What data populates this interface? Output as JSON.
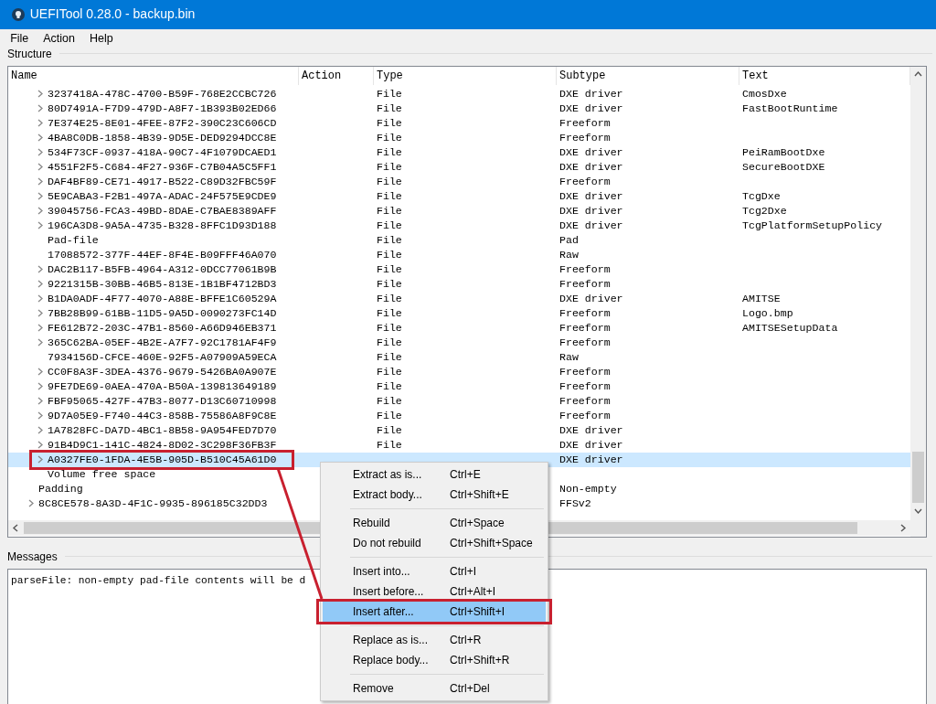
{
  "window": {
    "title": "UEFITool 0.28.0 - backup.bin"
  },
  "menu_bar": [
    "File",
    "Action",
    "Help"
  ],
  "structure": {
    "label": "Structure",
    "columns": [
      "Name",
      "Action",
      "Type",
      "Subtype",
      "Text"
    ],
    "items": [
      {
        "children": [
          {
            "name": "3237418A-478C-4700-B59F-768E2CCBC726",
            "type": "File",
            "subtype": "DXE driver",
            "text": "CmosDxe",
            "expandable": true,
            "selected": false
          },
          {
            "name": "80D7491A-F7D9-479D-A8F7-1B393B02ED66",
            "type": "File",
            "subtype": "DXE driver",
            "text": "FastBootRuntime",
            "expandable": true,
            "selected": false
          },
          {
            "name": "7E374E25-8E01-4FEE-87F2-390C23C606CD",
            "type": "File",
            "subtype": "Freeform",
            "expandable": true,
            "selected": false
          },
          {
            "name": "4BA8C0DB-1858-4B39-9D5E-DED9294DCC8E",
            "type": "File",
            "subtype": "Freeform",
            "expandable": true,
            "selected": false
          },
          {
            "name": "534F73CF-0937-418A-90C7-4F1079DCAED1",
            "type": "File",
            "subtype": "DXE driver",
            "text": "PeiRamBootDxe",
            "expandable": true,
            "selected": false
          },
          {
            "name": "4551F2F5-C684-4F27-936F-C7B04A5C5FF1",
            "type": "File",
            "subtype": "DXE driver",
            "text": "SecureBootDXE",
            "expandable": true,
            "selected": false
          },
          {
            "name": "DAF4BF89-CE71-4917-B522-C89D32FBC59F",
            "type": "File",
            "subtype": "Freeform",
            "expandable": true,
            "selected": false
          },
          {
            "name": "5E9CABA3-F2B1-497A-ADAC-24F575E9CDE9",
            "type": "File",
            "subtype": "DXE driver",
            "text": "TcgDxe",
            "expandable": true,
            "selected": false
          },
          {
            "name": "39045756-FCA3-49BD-8DAE-C7BAE8389AFF",
            "type": "File",
            "subtype": "DXE driver",
            "text": "Tcg2Dxe",
            "expandable": true,
            "selected": false
          },
          {
            "name": "196CA3D8-9A5A-4735-B328-8FFC1D93D188",
            "type": "File",
            "subtype": "DXE driver",
            "text": "TcgPlatformSetupPolicy",
            "expandable": true,
            "selected": false
          },
          {
            "name": "Pad-file",
            "type": "File",
            "subtype": "Pad",
            "expandable": false,
            "selected": false
          },
          {
            "name": "17088572-377F-44EF-8F4E-B09FFF46A070",
            "type": "File",
            "subtype": "Raw",
            "expandable": false,
            "selected": false
          },
          {
            "name": "DAC2B117-B5FB-4964-A312-0DCC77061B9B",
            "type": "File",
            "subtype": "Freeform",
            "expandable": true,
            "selected": false
          },
          {
            "name": "9221315B-30BB-46B5-813E-1B1BF4712BD3",
            "type": "File",
            "subtype": "Freeform",
            "expandable": true,
            "selected": false
          },
          {
            "name": "B1DA0ADF-4F77-4070-A88E-BFFE1C60529A",
            "type": "File",
            "subtype": "DXE driver",
            "text": "AMITSE",
            "expandable": true,
            "selected": false
          },
          {
            "name": "7BB28B99-61BB-11D5-9A5D-0090273FC14D",
            "type": "File",
            "subtype": "Freeform",
            "text": "Logo.bmp",
            "expandable": true,
            "selected": false
          },
          {
            "name": "FE612B72-203C-47B1-8560-A66D946EB371",
            "type": "File",
            "subtype": "Freeform",
            "text": "AMITSESetupData",
            "expandable": true,
            "selected": false
          },
          {
            "name": "365C62BA-05EF-4B2E-A7F7-92C1781AF4F9",
            "type": "File",
            "subtype": "Freeform",
            "expandable": true,
            "selected": false
          },
          {
            "name": "7934156D-CFCE-460E-92F5-A07909A59ECA",
            "type": "File",
            "subtype": "Raw",
            "expandable": false,
            "selected": false
          },
          {
            "name": "CC0F8A3F-3DEA-4376-9679-5426BA0A907E",
            "type": "File",
            "subtype": "Freeform",
            "expandable": true,
            "selected": false
          },
          {
            "name": "9FE7DE69-0AEA-470A-B50A-139813649189",
            "type": "File",
            "subtype": "Freeform",
            "expandable": true,
            "selected": false
          },
          {
            "name": "FBF95065-427F-47B3-8077-D13C60710998",
            "type": "File",
            "subtype": "Freeform",
            "expandable": true,
            "selected": false
          },
          {
            "name": "9D7A05E9-F740-44C3-858B-75586A8F9C8E",
            "type": "File",
            "subtype": "Freeform",
            "expandable": true,
            "selected": false
          },
          {
            "name": "1A7828FC-DA7D-4BC1-8B58-9A954FED7D70",
            "type": "File",
            "subtype": "DXE driver",
            "expandable": true,
            "selected": false
          },
          {
            "name": "91B4D9C1-141C-4824-8D02-3C298F36FB3F",
            "type": "File",
            "subtype": "DXE driver",
            "expandable": true,
            "selected": false
          },
          {
            "name": "A0327FE0-1FDA-4E5B-905D-B510C45A61D0",
            "subtype": "DXE driver",
            "expandable": true,
            "selected": true,
            "highlighted": true
          },
          {
            "name": "Volume free space",
            "expandable": false,
            "selected": false
          }
        ]
      },
      {
        "name": "Padding",
        "subtype": "Non-empty",
        "expandable": false,
        "selected": false
      },
      {
        "name": "8C8CE578-8A3D-4F1C-9935-896185C32DD3",
        "subtype": "FFSv2",
        "expandable": true,
        "selected": false
      }
    ]
  },
  "messages": {
    "label": "Messages",
    "lines": [
      "parseFile: non-empty pad-file contents will be d"
    ]
  },
  "context_menu": [
    {
      "kind": "item",
      "label": "Extract as is...",
      "shortcut": "Ctrl+E",
      "selected": false
    },
    {
      "kind": "item",
      "label": "Extract body...",
      "shortcut": "Ctrl+Shift+E",
      "selected": false
    },
    {
      "kind": "separator"
    },
    {
      "kind": "item",
      "label": "Rebuild",
      "shortcut": "Ctrl+Space",
      "selected": false
    },
    {
      "kind": "item",
      "label": "Do not rebuild",
      "shortcut": "Ctrl+Shift+Space",
      "selected": false
    },
    {
      "kind": "separator"
    },
    {
      "kind": "item",
      "label": "Insert into...",
      "shortcut": "Ctrl+I",
      "selected": false
    },
    {
      "kind": "item",
      "label": "Insert before...",
      "shortcut": "Ctrl+Alt+I",
      "selected": false
    },
    {
      "kind": "item",
      "label": "Insert after...",
      "shortcut": "Ctrl+Shift+I",
      "selected": true,
      "highlighted": true
    },
    {
      "kind": "separator"
    },
    {
      "kind": "item",
      "label": "Replace as is...",
      "shortcut": "Ctrl+R",
      "selected": false
    },
    {
      "kind": "item",
      "label": "Replace body...",
      "shortcut": "Ctrl+Shift+R",
      "selected": false
    },
    {
      "kind": "separator"
    },
    {
      "kind": "item",
      "label": "Remove",
      "shortcut": "Ctrl+Del",
      "selected": false
    }
  ]
}
